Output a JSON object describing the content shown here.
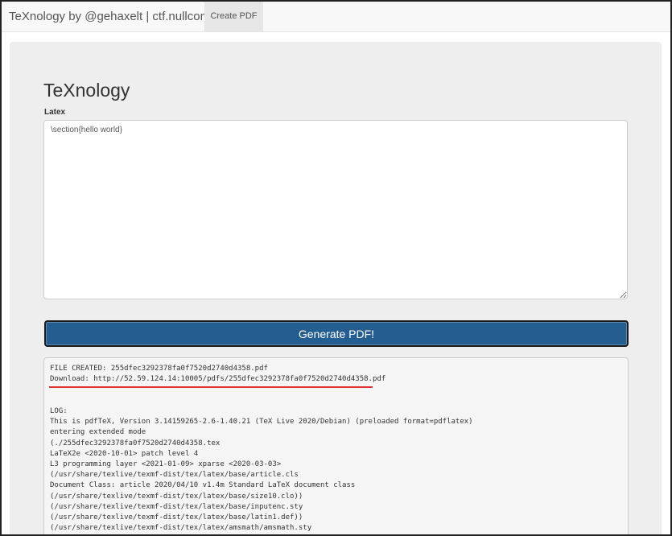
{
  "navbar": {
    "brand": "TeXnology by @gehaxelt | ctf.nullcon.net",
    "tab_create_pdf": "Create PDF"
  },
  "main": {
    "title": "TeXnology",
    "latex_label": "Latex",
    "latex_value": "\\section{hello world}",
    "generate_button": "Generate PDF!"
  },
  "output": {
    "file_created": "FILE CREATED: 255dfec3292378fa0f7520d2740d4358.pdf",
    "download": "Download: http://52.59.124.14:10005/pdfs/255dfec3292378fa0f7520d2740d4358.pdf",
    "log_lines": [
      "LOG:",
      "This is pdfTeX, Version 3.14159265-2.6-1.40.21 (TeX Live 2020/Debian) (preloaded format=pdflatex)",
      "entering extended mode",
      "(./255dfec3292378fa0f7520d2740d4358.tex",
      "LaTeX2e <2020-10-01> patch level 4",
      "L3 programming layer <2021-01-09> xparse <2020-03-03>",
      "(/usr/share/texlive/texmf-dist/tex/latex/base/article.cls",
      "Document Class: article 2020/04/10 v1.4m Standard LaTeX document class",
      "(/usr/share/texlive/texmf-dist/tex/latex/base/size10.clo))",
      "(/usr/share/texlive/texmf-dist/tex/latex/base/inputenc.sty",
      "(/usr/share/texlive/texmf-dist/tex/latex/base/latin1.def))",
      "(/usr/share/texlive/texmf-dist/tex/latex/amsmath/amsmath.sty"
    ]
  },
  "colors": {
    "button_bg": "#245e90",
    "highlight_underline": "#e03030"
  }
}
